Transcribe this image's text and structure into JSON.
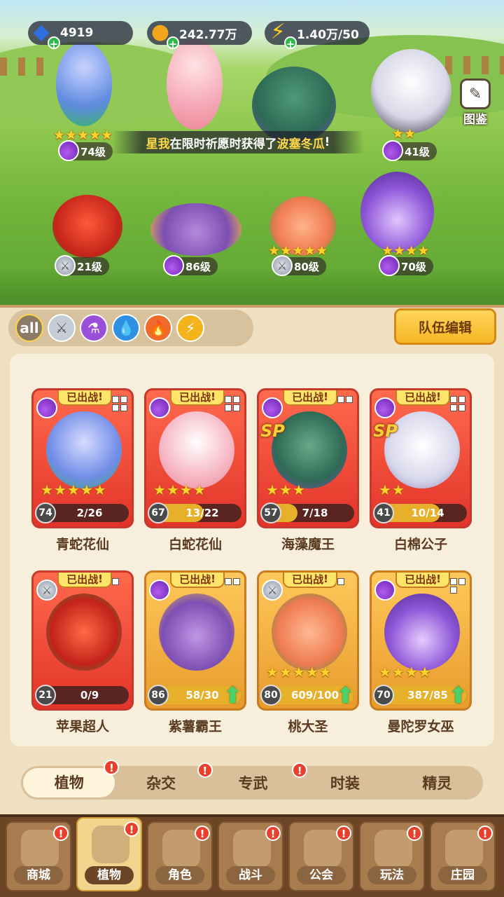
{
  "resources": {
    "gems": "4919",
    "coins": "242.77万",
    "energy": "1.40万/50"
  },
  "atlas_label": "图鉴",
  "banner": {
    "prefix": "星我",
    "middle": "在限时祈愿时获得了",
    "highlight": "波塞冬瓜",
    "suffix": "!"
  },
  "field_levels": [
    "74级",
    "41级",
    "21级",
    "86级",
    "80级",
    "70级"
  ],
  "filters": {
    "all_label": "all"
  },
  "team_edit": "队伍编辑",
  "deployed_tag": "已出战",
  "sp_label": "SP",
  "cards": [
    {
      "name": "青蛇花仙",
      "level": "74",
      "progress": "2/26",
      "stars": 5,
      "fill": 0.08,
      "class": "potion"
    },
    {
      "name": "白蛇花仙",
      "level": "67",
      "progress": "13/22",
      "stars": 4,
      "fill": 0.59,
      "class": "potion"
    },
    {
      "name": "海藻魔王",
      "level": "57",
      "progress": "7/18",
      "stars": 3,
      "fill": 0.39,
      "class": "potion"
    },
    {
      "name": "白棉公子",
      "level": "41",
      "progress": "10/14",
      "stars": 2,
      "fill": 0.71,
      "class": "potion"
    },
    {
      "name": "苹果超人",
      "level": "21",
      "progress": "0/9",
      "stars": 0,
      "fill": 0,
      "class": "sword"
    },
    {
      "name": "紫薯霸王",
      "level": "86",
      "progress": "58/30",
      "stars": 0,
      "fill": 1,
      "class": "potion"
    },
    {
      "name": "桃大圣",
      "level": "80",
      "progress": "609/100",
      "stars": 5,
      "fill": 1,
      "class": "sword"
    },
    {
      "name": "曼陀罗女巫",
      "level": "70",
      "progress": "387/85",
      "stars": 4,
      "fill": 1,
      "class": "potion"
    }
  ],
  "category_tabs": [
    "植物",
    "杂交",
    "专武",
    "时装",
    "精灵"
  ],
  "nav": [
    "商城",
    "植物",
    "角色",
    "战斗",
    "公会",
    "玩法",
    "庄园"
  ],
  "alert_mark": "!"
}
